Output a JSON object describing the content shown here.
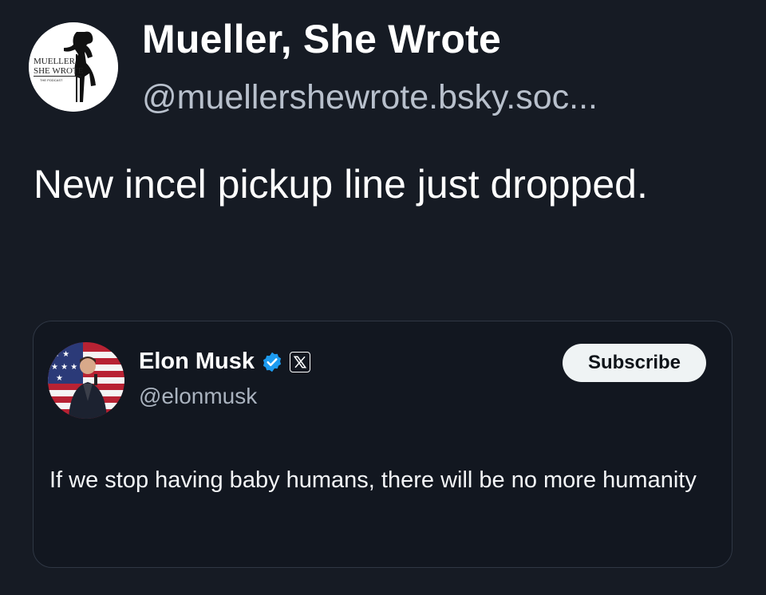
{
  "post": {
    "author": {
      "name": "Mueller, She Wrote",
      "handle": "@muellershewrote.bsky.soc...",
      "avatar_icon": "mueller-she-wrote-logo",
      "avatar_text": [
        "MUELLER,",
        "SHE WROTE",
        "THE PODCAST"
      ]
    },
    "text": "New incel pickup line just dropped."
  },
  "quoted_post": {
    "author": {
      "name": "Elon Musk",
      "handle": "@elonmusk",
      "avatar_icon": "elon-musk-avatar",
      "verified_icon": "verified-badge-icon",
      "platform_icon": "x-logo-icon"
    },
    "subscribe_label": "Subscribe",
    "text": "If we stop having baby humans, there will be no more humanity"
  },
  "colors": {
    "background": "#161b24",
    "card_background": "#121720",
    "card_border": "#2f3744",
    "verified": "#1d9bf0",
    "subscribe_bg": "#eff3f4"
  }
}
